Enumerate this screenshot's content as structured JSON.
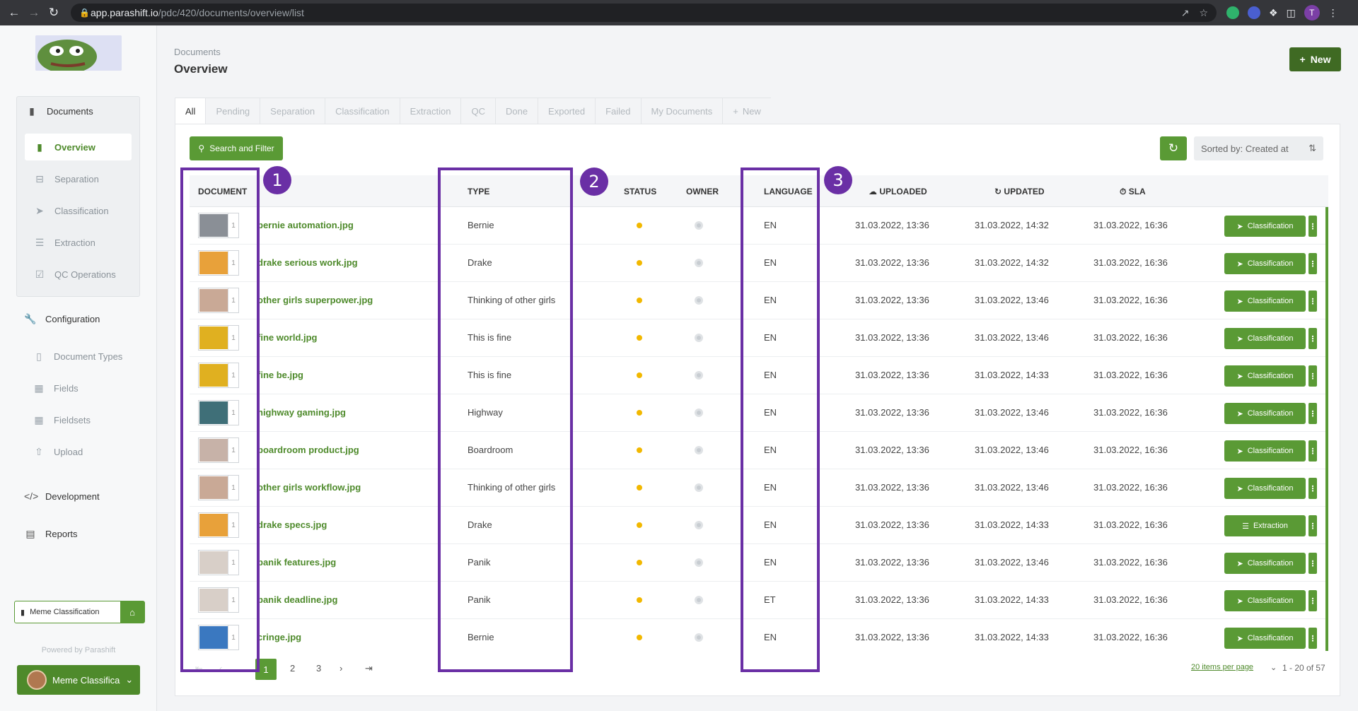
{
  "browser": {
    "url_host": "app.parashift.io",
    "url_path": "/pdc/420/documents/overview/list",
    "profile_initial": "T"
  },
  "sidebar": {
    "section_title": "Documents",
    "items": [
      {
        "label": "Overview",
        "icon": "document-icon",
        "active": true
      },
      {
        "label": "Separation",
        "icon": "separation-icon"
      },
      {
        "label": "Classification",
        "icon": "tags-icon"
      },
      {
        "label": "Extraction",
        "icon": "list-icon"
      },
      {
        "label": "QC Operations",
        "icon": "checklist-icon"
      }
    ],
    "configuration": {
      "label": "Configuration",
      "items": [
        {
          "label": "Document Types"
        },
        {
          "label": "Fields"
        },
        {
          "label": "Fieldsets"
        },
        {
          "label": "Upload"
        }
      ]
    },
    "development": "Development",
    "reports": "Reports",
    "workspace": "Meme Classification",
    "powered_by": "Powered by Parashift",
    "user": "Meme Classifica"
  },
  "header": {
    "breadcrumb": "Documents",
    "title": "Overview",
    "new_button": "New"
  },
  "tabs": [
    "All",
    "Pending",
    "Separation",
    "Classification",
    "Extraction",
    "QC",
    "Done",
    "Exported",
    "Failed",
    "My Documents",
    "New"
  ],
  "toolbar": {
    "search_filter": "Search and Filter",
    "sort_label": "Sorted by: Created at"
  },
  "columns": {
    "document": "DOCUMENT",
    "type": "TYPE",
    "status": "STATUS",
    "owner": "OWNER",
    "language": "LANGUAGE",
    "uploaded": "UPLOADED",
    "updated": "UPDATED",
    "sla": "SLA"
  },
  "rows": [
    {
      "name": "bernie automation.jpg",
      "pages": "1",
      "type": "Bernie",
      "lang": "EN",
      "uploaded": "31.03.2022, 13:36",
      "updated": "31.03.2022, 14:32",
      "sla": "31.03.2022, 16:36",
      "action": "Classification",
      "thumb": "#8a8f96"
    },
    {
      "name": "drake serious work.jpg",
      "pages": "1",
      "type": "Drake",
      "lang": "EN",
      "uploaded": "31.03.2022, 13:36",
      "updated": "31.03.2022, 14:32",
      "sla": "31.03.2022, 16:36",
      "action": "Classification",
      "thumb": "#e8a13a"
    },
    {
      "name": "other girls superpower.jpg",
      "pages": "1",
      "type": "Thinking of other girls",
      "lang": "EN",
      "uploaded": "31.03.2022, 13:36",
      "updated": "31.03.2022, 13:46",
      "sla": "31.03.2022, 16:36",
      "action": "Classification",
      "thumb": "#c9a996"
    },
    {
      "name": "fine world.jpg",
      "pages": "1",
      "type": "This is fine",
      "lang": "EN",
      "uploaded": "31.03.2022, 13:36",
      "updated": "31.03.2022, 13:46",
      "sla": "31.03.2022, 16:36",
      "action": "Classification",
      "thumb": "#e0b020"
    },
    {
      "name": "fine be.jpg",
      "pages": "1",
      "type": "This is fine",
      "lang": "EN",
      "uploaded": "31.03.2022, 13:36",
      "updated": "31.03.2022, 14:33",
      "sla": "31.03.2022, 16:36",
      "action": "Classification",
      "thumb": "#e0b020"
    },
    {
      "name": "highway gaming.jpg",
      "pages": "1",
      "type": "Highway",
      "lang": "EN",
      "uploaded": "31.03.2022, 13:36",
      "updated": "31.03.2022, 13:46",
      "sla": "31.03.2022, 16:36",
      "action": "Classification",
      "thumb": "#3f6f78"
    },
    {
      "name": "boardroom product.jpg",
      "pages": "1",
      "type": "Boardroom",
      "lang": "EN",
      "uploaded": "31.03.2022, 13:36",
      "updated": "31.03.2022, 13:46",
      "sla": "31.03.2022, 16:36",
      "action": "Classification",
      "thumb": "#c7b2a8"
    },
    {
      "name": "other girls workflow.jpg",
      "pages": "1",
      "type": "Thinking of other girls",
      "lang": "EN",
      "uploaded": "31.03.2022, 13:36",
      "updated": "31.03.2022, 13:46",
      "sla": "31.03.2022, 16:36",
      "action": "Classification",
      "thumb": "#c9a996"
    },
    {
      "name": "drake specs.jpg",
      "pages": "1",
      "type": "Drake",
      "lang": "EN",
      "uploaded": "31.03.2022, 13:36",
      "updated": "31.03.2022, 14:33",
      "sla": "31.03.2022, 16:36",
      "action": "Extraction",
      "thumb": "#e8a13a"
    },
    {
      "name": "panik features.jpg",
      "pages": "1",
      "type": "Panik",
      "lang": "EN",
      "uploaded": "31.03.2022, 13:36",
      "updated": "31.03.2022, 13:46",
      "sla": "31.03.2022, 16:36",
      "action": "Classification",
      "thumb": "#d8cfc8"
    },
    {
      "name": "panik deadline.jpg",
      "pages": "1",
      "type": "Panik",
      "lang": "ET",
      "uploaded": "31.03.2022, 13:36",
      "updated": "31.03.2022, 14:33",
      "sla": "31.03.2022, 16:36",
      "action": "Classification",
      "thumb": "#d8cfc8"
    },
    {
      "name": "cringe.jpg",
      "pages": "1",
      "type": "Bernie",
      "lang": "EN",
      "uploaded": "31.03.2022, 13:36",
      "updated": "31.03.2022, 14:33",
      "sla": "31.03.2022, 16:36",
      "action": "Classification",
      "thumb": "#3a78c0"
    }
  ],
  "pagination": {
    "current": "1",
    "pages": [
      "2",
      "3"
    ],
    "per_page": "20 items per page",
    "range": "1 - 20 of 57"
  },
  "annotations": [
    "1",
    "2",
    "3"
  ],
  "colors": {
    "accent": "#5a9a35",
    "accent_dark": "#3f6a23",
    "annotation": "#6a2fa5",
    "status_pending": "#f2b800"
  }
}
